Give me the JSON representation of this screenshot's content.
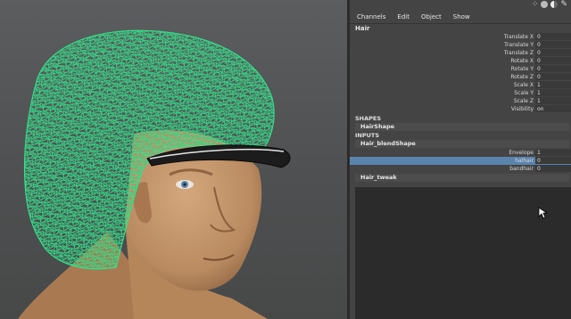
{
  "panel": {
    "menus": [
      "Channels",
      "Edit",
      "Object",
      "Show"
    ],
    "object_name": "Hair",
    "attributes": [
      {
        "label": "Translate X",
        "value": "0"
      },
      {
        "label": "Translate Y",
        "value": "0"
      },
      {
        "label": "Translate Z",
        "value": "0"
      },
      {
        "label": "Rotate X",
        "value": "0"
      },
      {
        "label": "Rotate Y",
        "value": "0"
      },
      {
        "label": "Rotate Z",
        "value": "0"
      },
      {
        "label": "Scale X",
        "value": "1"
      },
      {
        "label": "Scale Y",
        "value": "1"
      },
      {
        "label": "Scale Z",
        "value": "1"
      },
      {
        "label": "Visibility",
        "value": "on"
      }
    ],
    "shapes_header": "SHAPES",
    "shape_node": "HairShape",
    "inputs_header": "INPUTS",
    "blend_node": "Hair_blendShape",
    "blend_attributes": [
      {
        "label": "Envelope",
        "value": "1"
      },
      {
        "label": "halhair",
        "value": "0"
      },
      {
        "label": "bandhair",
        "value": "0"
      }
    ],
    "tweak_node": "Hair_tweak"
  },
  "colors": {
    "wireframe": "#33e08a",
    "selection": "#5b84ad",
    "skin": "#c4966b"
  }
}
